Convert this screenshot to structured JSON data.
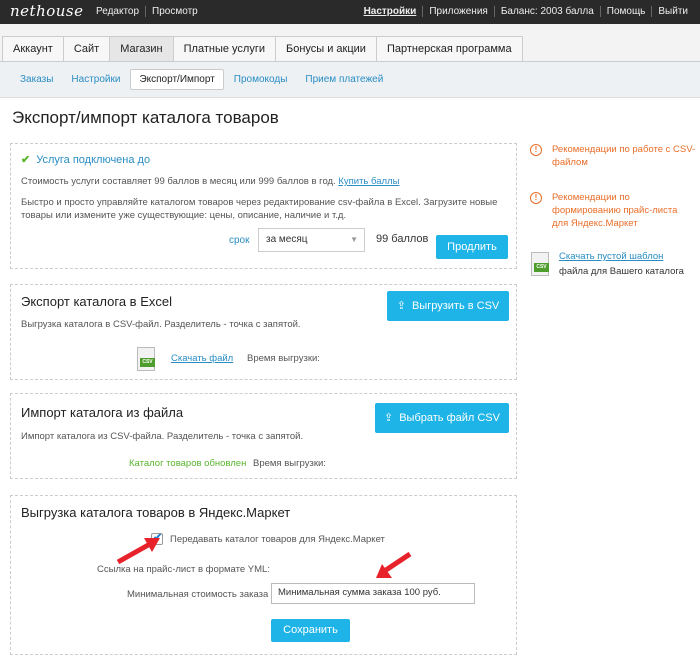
{
  "topbar": {
    "logo": "nethouse",
    "left_links": [
      "Редактор",
      "Просмотр"
    ],
    "right_links": [
      "Настройки",
      "Приложения",
      "Баланс: 2003 балла",
      "Помощь",
      "Выйти"
    ]
  },
  "main_tabs": [
    "Аккаунт",
    "Сайт",
    "Магазин",
    "Платные услуги",
    "Бонусы и акции",
    "Партнерская программа"
  ],
  "sub_tabs": [
    "Заказы",
    "Настройки",
    "Экспорт/Импорт",
    "Промокоды",
    "Прием платежей"
  ],
  "page_title": "Экспорт/импорт каталога товаров",
  "service": {
    "status": "Услуга подключена до",
    "cost_text": "Стоимость услуги составляет 99 баллов в месяц или 999 баллов в год.",
    "buy_link": "Купить баллы",
    "desc_line1": "Быстро и просто управляйте каталогом товаров через редактирование csv-файла в Excel. Загрузите новые",
    "desc_line2": "товары или измените уже существующие: цены, описание, наличие и т.д.",
    "srok_label": "срок",
    "period_value": "за месяц",
    "price": "99 баллов",
    "extend_button": "Продлить"
  },
  "export": {
    "title": "Экспорт каталога в Excel",
    "desc": "Выгрузка каталога в CSV-файл. Разделитель - точка с запятой.",
    "button": "Выгрузить в CSV",
    "download_link": "Скачать файл",
    "time_label": "Время выгрузки:",
    "csv_tag": "CSV"
  },
  "import": {
    "title": "Импорт каталога из файла",
    "desc": "Импорт каталога из CSV-файла. Разделитель - точка с запятой.",
    "button": "Выбрать файл CSV",
    "status": "Каталог товаров обновлен",
    "time_label": "Время выгрузки:"
  },
  "yandex": {
    "title": "Выгрузка каталога товаров в Яндекс.Маркет",
    "checkbox_label": "Передавать каталог товаров для Яндекс.Маркет",
    "yml_label": "Ссылка на прайс-лист в формате YML:",
    "min_order_label": "Минимальная стоимость заказа",
    "min_order_value": "Минимальная сумма заказа 100 руб.",
    "save_button": "Сохранить"
  },
  "sidebar": {
    "rec1": "Рекомендации по работе с CSV-файлом",
    "rec2": "Рекомендации по формированию прайс-листа для Яндекс.Маркет",
    "template_link": "Скачать пустой шаблон",
    "template_text": "файла для Вашего каталога",
    "csv_tag": "CSV"
  },
  "colors": {
    "accent_blue": "#1eb4e7",
    "link_blue": "#2a8dc4",
    "warning_orange": "#e96e2a",
    "success_green": "#5ab52f",
    "arrow_red": "#e8222a"
  }
}
